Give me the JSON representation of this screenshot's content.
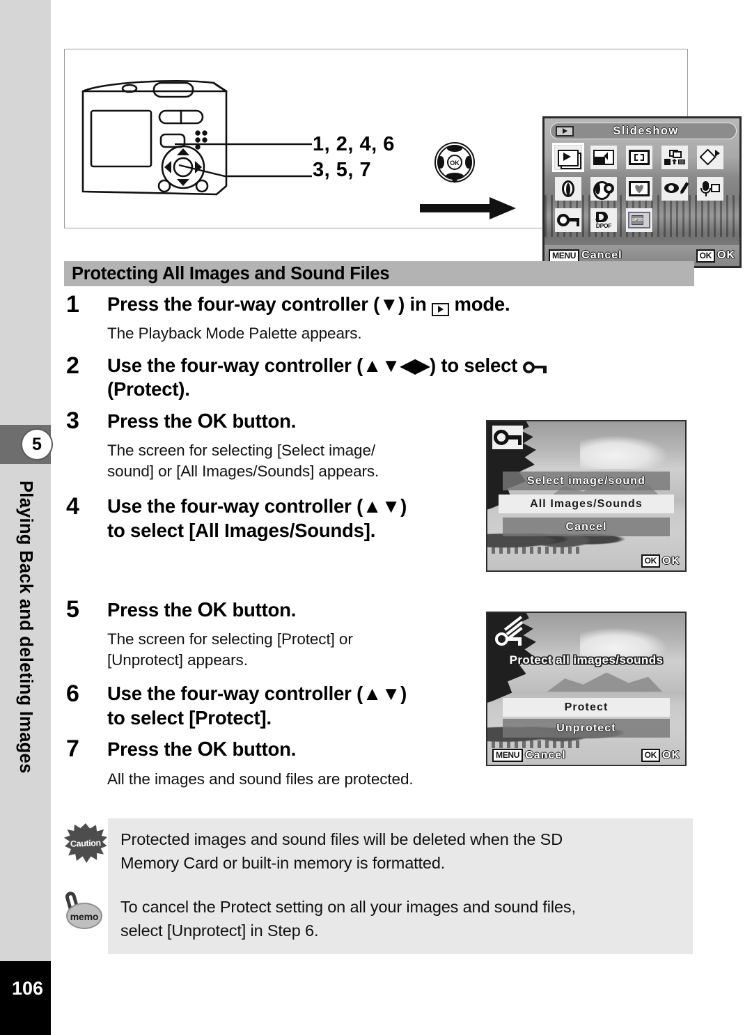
{
  "sidebar": {
    "chapter_number": "5",
    "chapter_title": "Playing Back and deleting Images",
    "page_number": "106"
  },
  "figure": {
    "callout_line1": "1, 2, 4, 6",
    "callout_line2": "3, 5, 7",
    "camera_icon": "camera-back-illustration",
    "four_way_icon": "four-way-controller-illustration",
    "arrow_icon": "right-arrow"
  },
  "palette_screen": {
    "mode_icon": "playback-mode-icon",
    "title": "Slideshow",
    "icons": [
      [
        {
          "name": "slideshow-icon",
          "selected": true
        },
        {
          "name": "resize-icon",
          "selected": false
        },
        {
          "name": "trimming-icon",
          "selected": false
        },
        {
          "name": "image-copy-icon",
          "selected": false
        },
        {
          "name": "image-rotation-icon",
          "selected": false
        }
      ],
      [
        {
          "name": "digital-filter-icon",
          "selected": false
        },
        {
          "name": "brightness-filter-icon",
          "selected": false
        },
        {
          "name": "frame-composite-icon",
          "selected": false
        },
        {
          "name": "red-eye-compensation-icon",
          "selected": false
        },
        {
          "name": "voice-memo-icon",
          "selected": false
        }
      ],
      [
        {
          "name": "protect-key-icon",
          "selected": false
        },
        {
          "name": "dpof-icon",
          "selected": false
        },
        {
          "name": "start-up-screen-icon",
          "selected": false
        }
      ]
    ],
    "dpof_label": "DPOF",
    "menu_badge": "MENU",
    "cancel_label": "Cancel",
    "ok_badge": "OK",
    "ok_label": "OK"
  },
  "section": {
    "heading": "Protecting All Images and Sound Files"
  },
  "steps": [
    {
      "number": "1",
      "title_pre": "Press the four-way controller (▼) in ",
      "title_post": " mode.",
      "icon": "playback-mode-icon",
      "description": "The Playback Mode Palette appears."
    },
    {
      "number": "2",
      "title_pre": "Use the four-way controller (▲▼◀▶) to select ",
      "title_post": "(Protect).",
      "icon": "protect-key-icon",
      "description": ""
    },
    {
      "number": "3",
      "title_pre": "Press the ",
      "ok_word": "OK",
      "title_post": " button.",
      "description": "The screen for selecting [Select image/ sound] or [All Images/Sounds] appears."
    },
    {
      "number": "4",
      "title_pre": "Use the four-way controller (▲▼) to select [All Images/Sounds].",
      "description": ""
    },
    {
      "number": "5",
      "title_pre": "Press the ",
      "ok_word": "OK",
      "title_post": " button.",
      "description": "The screen for selecting [Protect] or [Unprotect] appears."
    },
    {
      "number": "6",
      "title_pre": "Use the four-way controller (▲▼) to select [Protect].",
      "description": ""
    },
    {
      "number": "7",
      "title_pre": "Press the ",
      "ok_word": "OK",
      "title_post": " button.",
      "description": "All the images and sound files are protected."
    }
  ],
  "step_text": {
    "s1_title_a": "Press the four-way controller (▼) in",
    "s1_title_b": "mode.",
    "s1_desc": "The Playback Mode Palette appears.",
    "s2_title_a": "Use the four-way controller (▲▼◀▶) to select",
    "s2_title_b": "(Protect).",
    "s3_title_a": "Press the",
    "s3_ok": "OK",
    "s3_title_b": "button.",
    "s3_desc_l1": "The screen for selecting [Select image/",
    "s3_desc_l2": "sound] or [All Images/Sounds] appears.",
    "s4_title_l1": "Use the four-way controller (▲▼)",
    "s4_title_l2": "to select [All Images/Sounds].",
    "s5_title_a": "Press the",
    "s5_ok": "OK",
    "s5_title_b": "button.",
    "s5_desc_l1": "The screen for selecting [Protect] or",
    "s5_desc_l2": "[Unprotect] appears.",
    "s6_title_l1": "Use the four-way controller (▲▼)",
    "s6_title_l2": "to select [Protect].",
    "s7_title_a": "Press the",
    "s7_ok": "OK",
    "s7_title_b": "button.",
    "s7_desc": "All the images and sound files are protected."
  },
  "select_screen": {
    "corner_icon": "protect-key-icon",
    "items": [
      {
        "label": "Select image/sound",
        "selected": false
      },
      {
        "label": "All Images/Sounds",
        "selected": true
      },
      {
        "label": "Cancel",
        "selected": false
      }
    ],
    "ok_badge": "OK",
    "ok_label": "OK"
  },
  "protect_screen": {
    "corner_icon": "protect-all-key-icon",
    "title": "Protect all images/sounds",
    "items": [
      {
        "label": "Protect",
        "selected": true
      },
      {
        "label": "Unprotect",
        "selected": false
      }
    ],
    "menu_badge": "MENU",
    "cancel_label": "Cancel",
    "ok_badge": "OK",
    "ok_label": "OK"
  },
  "notes": {
    "caution": {
      "badge": "Caution",
      "icon": "caution-burst-icon",
      "line1": "Protected images and sound files will be deleted when the SD",
      "line2": "Memory Card or built-in memory is formatted."
    },
    "memo": {
      "badge": "memo",
      "icon": "memo-note-icon",
      "line1": "To cancel the Protect setting on all your images and sound files,",
      "line2": "select [Unprotect] in Step 6."
    }
  },
  "colors": {
    "sidebar_gray": "#d6d6d6",
    "chapter_tab_gray": "#6e6e6e",
    "heading_band": "#b3b3b3",
    "note_bg": "#e8e8e8",
    "page_number_bg": "#000000"
  }
}
